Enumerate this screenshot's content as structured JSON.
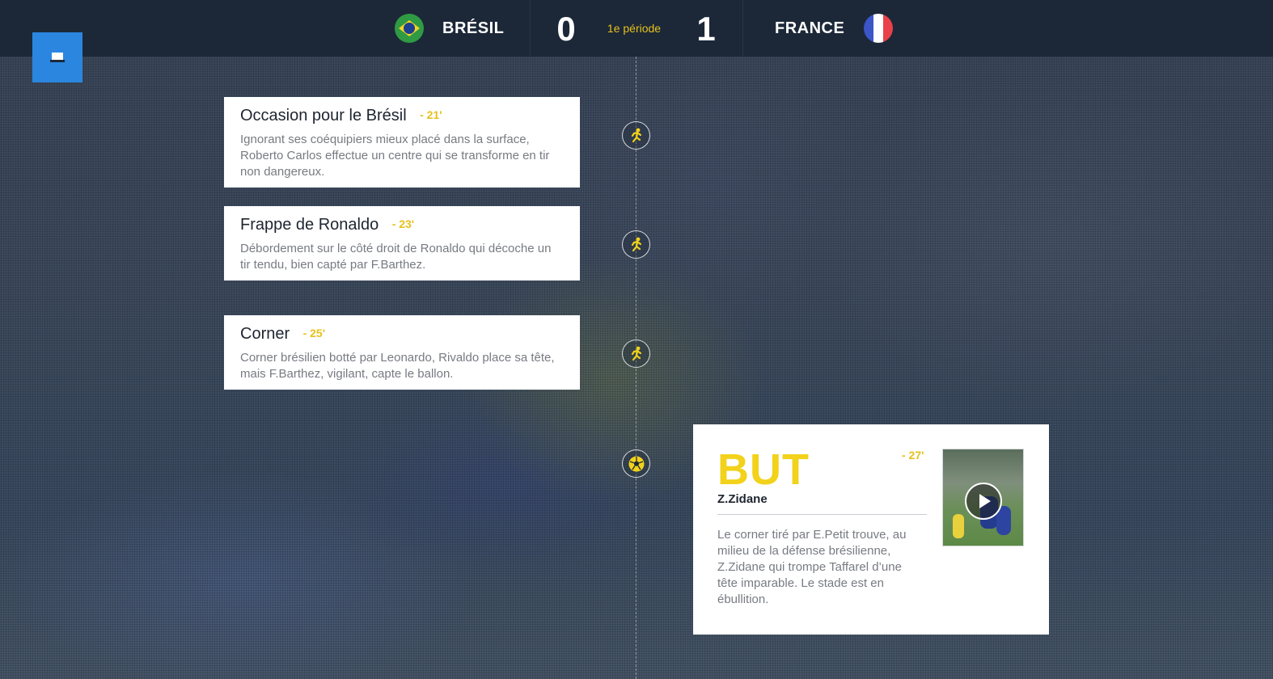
{
  "scoreboard": {
    "home_team": "BRÉSIL",
    "home_score": "0",
    "period": "1e période",
    "away_score": "1",
    "away_team": "FRANCE"
  },
  "menu_button": {
    "icon": "menu-icon"
  },
  "events": [
    {
      "title": "Occasion pour le Brésil",
      "time": "- 21'",
      "text": "Ignorant ses coéquipiers mieux placé dans la surface, Roberto Carlos effectue un centre qui se transforme en tir non dangereux.",
      "icon": "kick-icon"
    },
    {
      "title": "Frappe de Ronaldo",
      "time": "- 23'",
      "text": "Débordement sur le côté droit de Ronaldo qui décoche un tir tendu, bien capté par F.Barthez.",
      "icon": "kick-icon"
    },
    {
      "title": "Corner",
      "time": "- 25'",
      "text": "Corner brésilien botté par Leonardo, Rivaldo place sa tête, mais F.Barthez, vigilant, capte le ballon.",
      "icon": "kick-icon"
    }
  ],
  "goal": {
    "label": "BUT",
    "time": "- 27'",
    "scorer": "Z.Zidane",
    "text": "Le corner tiré par E.Petit trouve, au milieu de la défense brésilienne, Z.Zidane qui trompe Taffarel d’une tête imparable. Le stade est en ébullition.",
    "icon": "ball-icon",
    "video_icon": "play-icon"
  },
  "colors": {
    "accent_yellow": "#e6c11d",
    "topbar": "#1c2838",
    "menu_blue": "#2b86e0"
  }
}
